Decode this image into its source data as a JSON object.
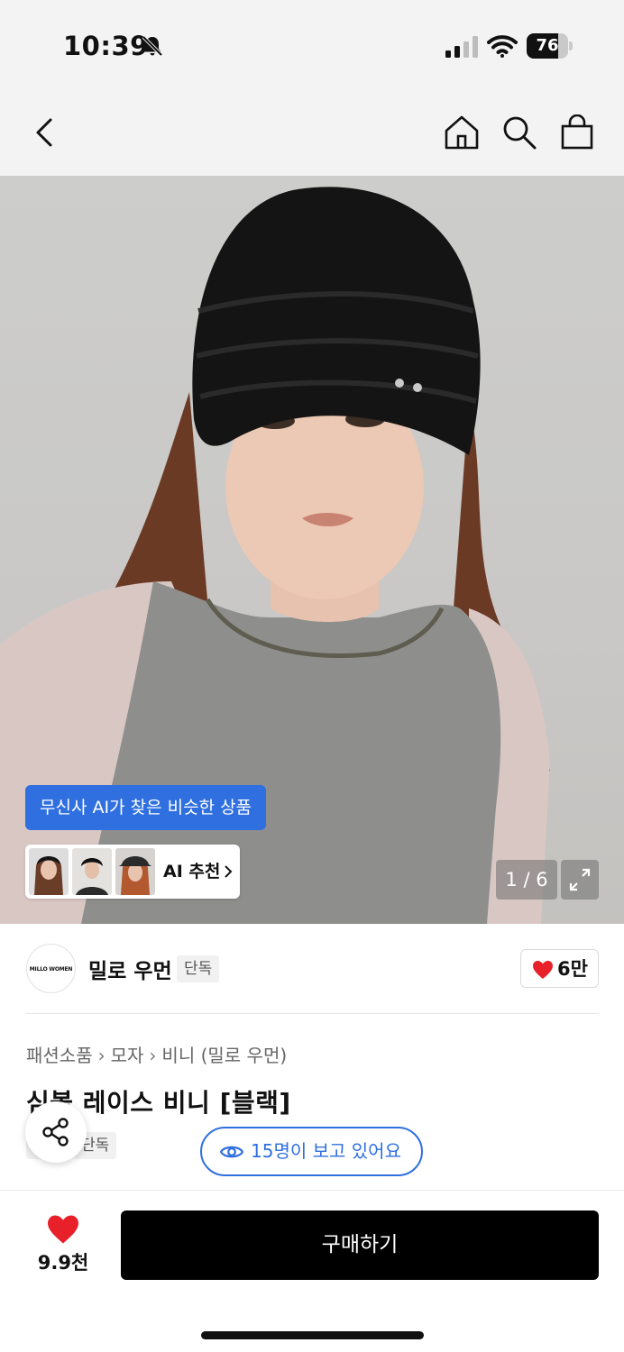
{
  "status_bar": {
    "time": "10:39",
    "battery": "76",
    "battery_level": 0.76
  },
  "nav": {
    "icons": [
      "back-icon",
      "home-icon",
      "search-icon",
      "shopping-bag-icon"
    ]
  },
  "hero": {
    "ai_banner": "무신사 AI가 찾은 비슷한 상품",
    "ai_recommend_label": "AI 추천",
    "pager": "1 / 6"
  },
  "brand": {
    "logo_text": "MILLO WOMEN",
    "name": "밀로 우먼",
    "tag": "단독",
    "likes": "6만"
  },
  "breadcrumb": [
    "패션소품",
    "모자",
    "비니 (밀로 우먼)"
  ],
  "product": {
    "title": "심볼 레이스 비니 [블랙]",
    "tag": "단독",
    "viewers": "15명이 보고 있어요"
  },
  "bottom_bar": {
    "likes": "9.9천",
    "buy_label": "구매하기"
  },
  "colors": {
    "accent_blue": "#2f6fe0",
    "heart_red": "#e8202a",
    "buy_black": "#000000"
  }
}
